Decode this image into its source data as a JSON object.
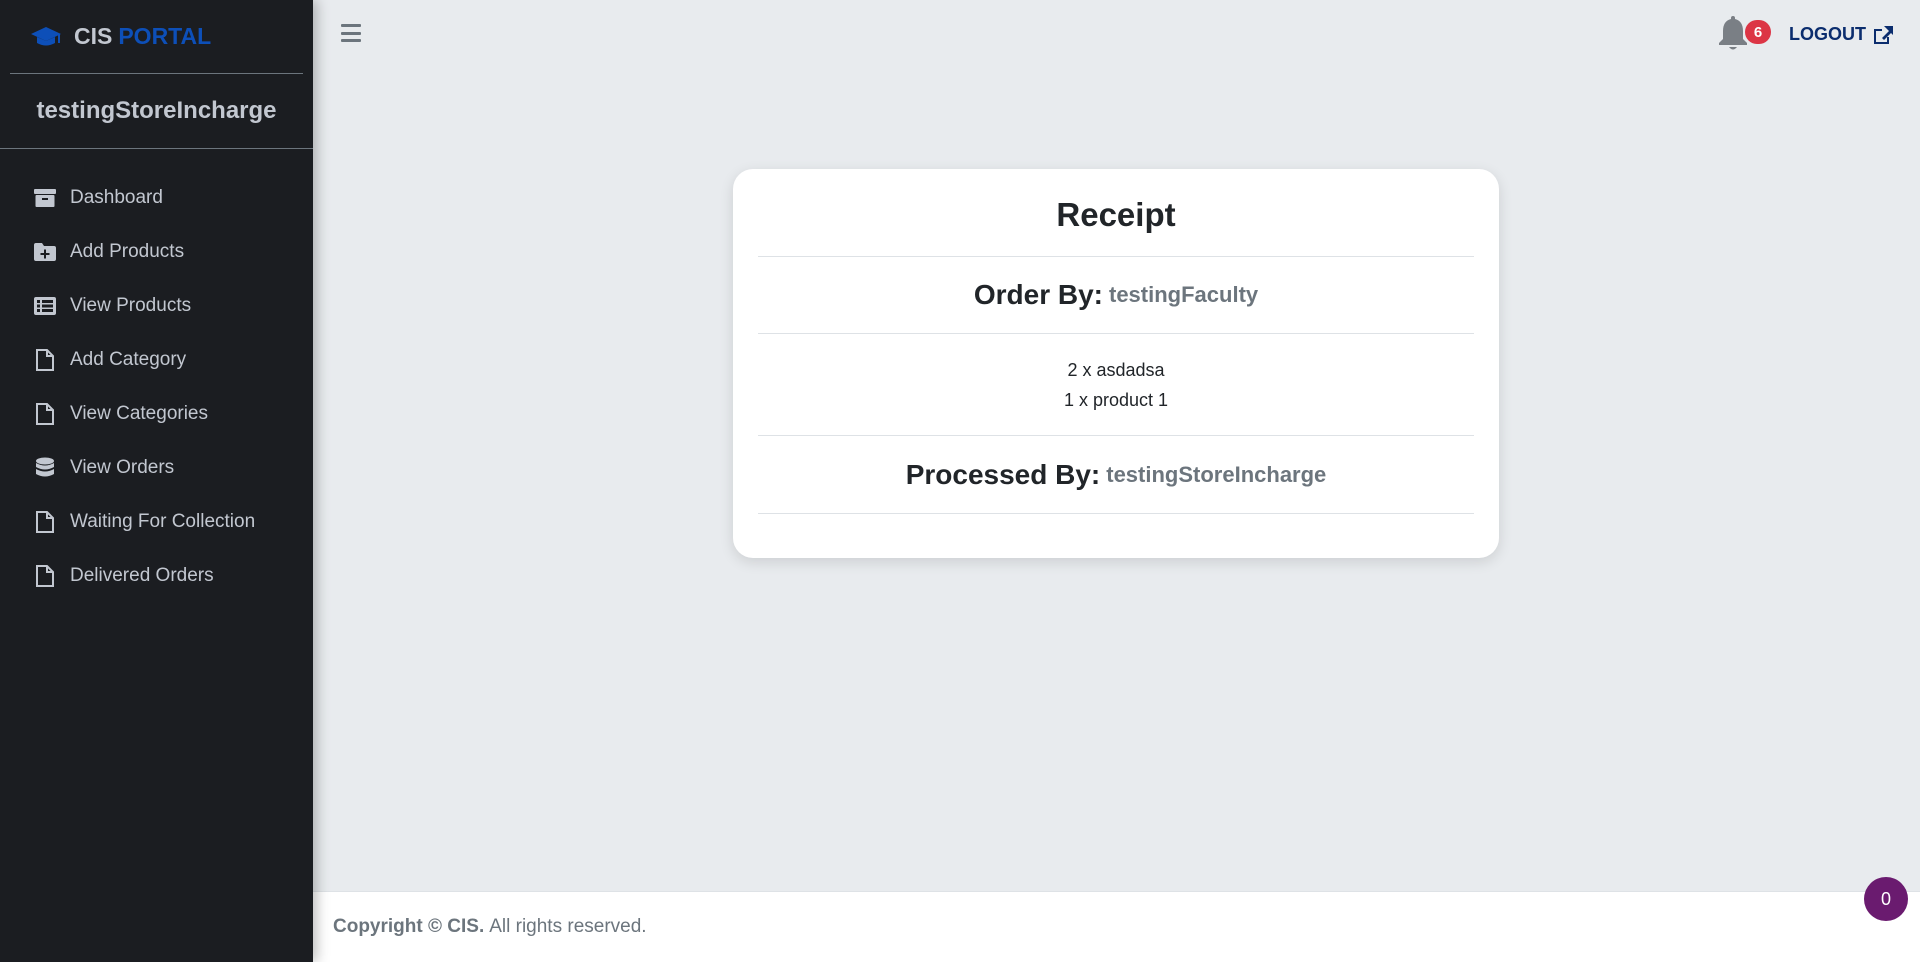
{
  "brand": {
    "part1": "CIS",
    "part2": "PORTAL",
    "icon": "graduation-cap-icon",
    "accent": "#0d4fb8"
  },
  "user": {
    "name": "testingStoreIncharge"
  },
  "sidebar": {
    "items": [
      {
        "label": "Dashboard",
        "icon": "archive-icon"
      },
      {
        "label": "Add Products",
        "icon": "folder-plus-icon"
      },
      {
        "label": "View Products",
        "icon": "list-icon"
      },
      {
        "label": "Add Category",
        "icon": "file-icon"
      },
      {
        "label": "View Categories",
        "icon": "file-icon"
      },
      {
        "label": "View Orders",
        "icon": "database-icon"
      },
      {
        "label": "Waiting For Collection",
        "icon": "file-icon"
      },
      {
        "label": "Delivered Orders",
        "icon": "file-icon"
      }
    ]
  },
  "topbar": {
    "notifications_count": "6",
    "logout_label": "LOGOUT",
    "badge_color": "#dc3545"
  },
  "receipt": {
    "title": "Receipt",
    "order_by_label": "Order By:",
    "order_by_value": "testingFaculty",
    "items": [
      "2 x asdadsa",
      "1 x product 1"
    ],
    "processed_by_label": "Processed By:",
    "processed_by_value": "testingStoreIncharge"
  },
  "footer": {
    "copyright_bold": "Copyright © CIS.",
    "rights": "All rights reserved."
  },
  "chat": {
    "count": "0",
    "color": "#6a1b6f"
  }
}
